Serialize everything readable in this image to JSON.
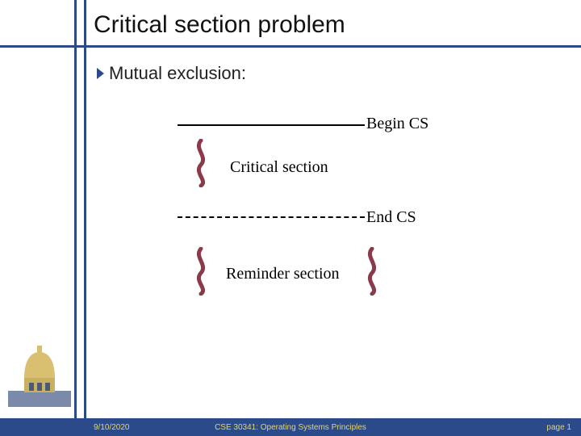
{
  "title": "Critical section problem",
  "bullet": "Mutual exclusion:",
  "diagram": {
    "begin": "Begin CS",
    "critical": "Critical section",
    "end": "End CS",
    "reminder": "Reminder section"
  },
  "footer": {
    "date": "9/10/2020",
    "course": "CSE 30341: Operating Systems Principles",
    "page": "page 1"
  }
}
